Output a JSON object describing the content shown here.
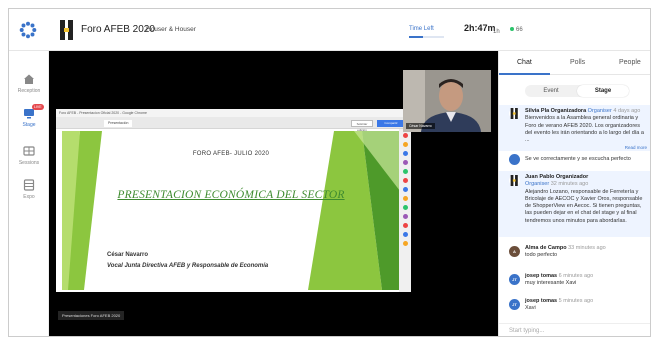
{
  "header": {
    "event_title": "Foro AFEB 2020",
    "owner": "Houser & Houser",
    "time_left_label": "Time Left",
    "time_left_value": "2h:47m",
    "time_left_unit": "1h",
    "time_left_progress": 0.4,
    "viewers": "66",
    "brand_color": "#3a73c9"
  },
  "nav": {
    "items": [
      {
        "label": "Reception",
        "icon": "home-icon"
      },
      {
        "label": "Stage",
        "icon": "stage-icon",
        "badge": "LIVE"
      },
      {
        "label": "Sessions",
        "icon": "sessions-icon"
      },
      {
        "label": "Expo",
        "icon": "expo-icon"
      }
    ]
  },
  "stage": {
    "speaker_tag": "César Navarro",
    "shared_label": "Presentaciones Foro AFEB 2020",
    "window_title": "Foro AFEB - Presentacion Oficial 2020 - Google Chrome",
    "window_tab": "Presentación",
    "window_btn": "Solicitar edición",
    "window_btn2": "Compartir",
    "slide": {
      "head": "FORO AFEB- JULIO 2020",
      "title": "PRESENTACION ECONÓMICA DEL SECTOR",
      "name": "César Navarro",
      "role": "Vocal Junta Directiva AFEB y Responsable de Economía"
    }
  },
  "panel": {
    "tabs": [
      "Chat",
      "Polls",
      "People"
    ],
    "segment": [
      "Event",
      "Stage"
    ],
    "messages": [
      {
        "initials": "H",
        "name": "Silvia Pla Organizadora",
        "role": "Organiser",
        "time": "4 days ago",
        "text": "Bienvenidos a la Asamblea general ordinaria y Foro de verano AFEB 2020. Los organizadores del evento les irán orientando a lo largo del día a ...",
        "more": "Read more",
        "color": "#2a2a2a"
      },
      {
        "initials": "",
        "name": "",
        "role": "",
        "time": "",
        "text": "Se ve correctamente y se escucha perfecto",
        "more": "",
        "color": "#3a73c9"
      },
      {
        "initials": "H",
        "name": "Juan Pablo Organizador",
        "role": "Organiser",
        "time": "32 minutes ago",
        "text": "Alejandro Lozano, responsable de Ferretería y Bricolaje de AECOC y Xavier Oros, responsable de ShopperView en Aecoc. Si tienen preguntas, las pueden dejar en el chat del stage y al final tendremos unos minutos para abordarlas.",
        "more": "",
        "color": "#2a2a2a"
      },
      {
        "initials": "A",
        "name": "Alma de Campo",
        "role": "",
        "time": "33 minutes ago",
        "text": "todo perfecto",
        "more": "",
        "color": "#6b4e3a"
      },
      {
        "initials": "JT",
        "name": "josep tomas",
        "role": "",
        "time": "6 minutes ago",
        "text": "muy interesante Xavi",
        "more": "",
        "color": "#3a73c9"
      },
      {
        "initials": "JT",
        "name": "josep tomas",
        "role": "",
        "time": "5 minutes ago",
        "text": "Xavi",
        "more": "",
        "color": "#3a73c9"
      }
    ],
    "input_placeholder": "Start typing..."
  }
}
